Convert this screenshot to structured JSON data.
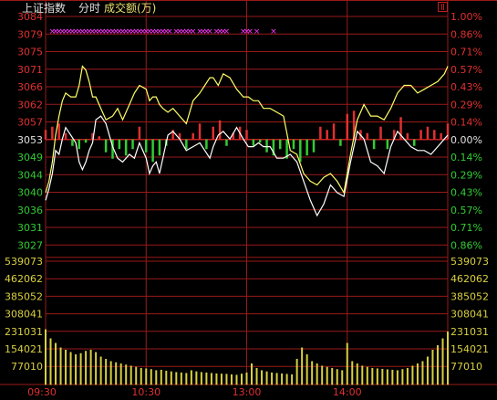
{
  "header": {
    "index_name": "上证指数",
    "time_mode": "分时",
    "volume_label": "成交额(万)"
  },
  "colors": {
    "up": "#e03030",
    "down": "#33cc33",
    "flat": "#e0e0e0",
    "grid": "#9a1a1a",
    "volume": "#d9d040",
    "price_line": "#ffffff",
    "avg_line": "#ffff66",
    "signal_marker": "#ff33ff"
  },
  "chart_data": {
    "type": "line",
    "title": "",
    "price_axis": {
      "left_ticks": [
        "3084",
        "3079",
        "3075",
        "3071",
        "3066",
        "3062",
        "3057",
        "3053",
        "3049",
        "3044",
        "3040",
        "3036",
        "3031",
        "3027"
      ],
      "right_ticks": [
        "1.00%",
        "0.86%",
        "0.71%",
        "0.57%",
        "0.43%",
        "0.29%",
        "0.14%",
        "0.00%",
        "0.14%",
        "0.29%",
        "0.43%",
        "0.57%",
        "0.71%",
        "0.86%"
      ],
      "prev_close": 3053,
      "ylim": [
        3022.5,
        3084
      ]
    },
    "volume_axis": {
      "ticks": [
        "539073",
        "462062",
        "385052",
        "308041",
        "231031",
        "154021",
        "77010"
      ],
      "ylim": [
        0,
        616084
      ]
    },
    "time_axis": {
      "ticks": [
        "09:30",
        "10:30",
        "13:00",
        "14:00"
      ],
      "total_minutes": 240
    },
    "series": [
      {
        "name": "",
        "role": "price",
        "x": [
          0,
          2,
          4,
          6,
          8,
          10,
          12,
          15,
          18,
          20,
          22,
          24,
          26,
          28,
          30,
          33,
          36,
          40,
          43,
          46,
          50,
          53,
          56,
          60,
          62,
          64,
          66,
          68,
          70,
          73,
          76,
          80,
          84,
          88,
          92,
          95,
          98,
          100,
          103,
          106,
          110,
          114,
          118,
          121,
          124,
          127,
          130,
          134,
          138,
          142,
          146,
          150,
          154,
          158,
          162,
          166,
          170,
          174,
          178,
          182,
          186,
          190,
          194,
          198,
          202,
          206,
          210,
          214,
          218,
          222,
          226,
          230,
          234,
          238,
          240
        ],
        "values": [
          3036,
          3039,
          3043,
          3049,
          3048,
          3052,
          3055,
          3053,
          3051,
          3046,
          3044,
          3046,
          3049,
          3051,
          3057,
          3058,
          3056,
          3050,
          3047,
          3046,
          3048,
          3047,
          3051,
          3047,
          3043,
          3045,
          3046,
          3043,
          3047,
          3053,
          3054,
          3052,
          3049,
          3050,
          3051,
          3049,
          3047,
          3050,
          3053,
          3054,
          3052,
          3055,
          3052,
          3050,
          3050,
          3051,
          3050,
          3050,
          3047,
          3047,
          3048,
          3046,
          3041,
          3036,
          3032,
          3035,
          3040,
          3038,
          3037,
          3046,
          3054,
          3052,
          3046,
          3045,
          3043,
          3050,
          3054,
          3052,
          3050,
          3049,
          3049,
          3048,
          3050,
          3052,
          3053
        ]
      },
      {
        "name": "",
        "role": "average",
        "x": [
          0,
          2,
          4,
          6,
          8,
          10,
          12,
          15,
          18,
          20,
          22,
          24,
          26,
          28,
          30,
          33,
          36,
          40,
          43,
          46,
          50,
          53,
          56,
          60,
          62,
          64,
          66,
          68,
          70,
          73,
          76,
          80,
          84,
          88,
          92,
          95,
          98,
          100,
          103,
          106,
          110,
          114,
          118,
          121,
          124,
          127,
          130,
          134,
          138,
          142,
          146,
          150,
          154,
          158,
          162,
          166,
          170,
          174,
          178,
          182,
          186,
          190,
          194,
          198,
          202,
          206,
          210,
          214,
          218,
          222,
          226,
          230,
          234,
          238,
          240
        ],
        "values": [
          3038,
          3041,
          3046,
          3053,
          3058,
          3062,
          3064,
          3063,
          3063,
          3066,
          3071,
          3070,
          3067,
          3063,
          3063,
          3060,
          3057,
          3058,
          3060,
          3057,
          3061,
          3064,
          3066,
          3065,
          3062,
          3063,
          3063,
          3061,
          3060,
          3059,
          3060,
          3058,
          3056,
          3062,
          3064,
          3066,
          3068,
          3068,
          3066,
          3069,
          3068,
          3065,
          3063,
          3063,
          3062,
          3062,
          3060,
          3060,
          3059,
          3058,
          3049,
          3048,
          3043,
          3041,
          3040,
          3042,
          3043,
          3041,
          3038,
          3048,
          3057,
          3061,
          3058,
          3058,
          3057,
          3060,
          3064,
          3066,
          3066,
          3064,
          3065,
          3066,
          3067,
          3069,
          3071
        ]
      }
    ],
    "bars": [
      {
        "role": "up_down",
        "x": [
          0,
          4,
          8,
          12,
          16,
          20,
          24,
          28,
          32,
          36,
          40,
          44,
          48,
          52,
          56,
          60,
          64,
          68,
          72,
          76,
          80,
          84,
          88,
          92,
          96,
          100,
          104,
          108,
          112,
          116,
          120,
          124,
          128,
          132,
          136,
          140,
          144,
          148,
          152,
          156,
          160,
          164,
          168,
          172,
          176,
          180,
          184,
          188,
          192,
          196,
          200,
          204,
          208,
          212,
          216,
          220,
          224,
          228,
          232,
          236,
          240
        ],
        "values": [
          3,
          4,
          5,
          2,
          -2,
          -3,
          -1,
          2,
          1,
          -4,
          -6,
          -3,
          -5,
          -3,
          4,
          -4,
          -7,
          -5,
          -2,
          3,
          2,
          -3,
          2,
          5,
          -3,
          4,
          6,
          -2,
          2,
          4,
          3,
          -2,
          -1,
          -4,
          -5,
          -3,
          -6,
          -3,
          -7,
          -5,
          -4,
          4,
          3,
          5,
          -2,
          8,
          9,
          3,
          2,
          -3,
          4,
          -3,
          3,
          7,
          2,
          -2,
          3,
          4,
          3,
          2,
          5
        ]
      }
    ],
    "volume": {
      "x": [
        0,
        3,
        6,
        9,
        12,
        15,
        18,
        21,
        24,
        27,
        30,
        33,
        36,
        39,
        42,
        45,
        48,
        51,
        54,
        57,
        60,
        63,
        66,
        69,
        72,
        75,
        78,
        81,
        84,
        87,
        90,
        93,
        96,
        99,
        102,
        105,
        108,
        111,
        114,
        117,
        120,
        123,
        126,
        129,
        132,
        135,
        138,
        141,
        144,
        147,
        150,
        153,
        156,
        159,
        162,
        165,
        168,
        171,
        174,
        177,
        180,
        183,
        186,
        189,
        192,
        195,
        198,
        201,
        204,
        207,
        210,
        213,
        216,
        219,
        222,
        225,
        228,
        231,
        234,
        237,
        240
      ],
      "values": [
        240000,
        200000,
        180000,
        160000,
        150000,
        140000,
        130000,
        135000,
        145000,
        150000,
        140000,
        120000,
        110000,
        100000,
        95000,
        90000,
        85000,
        80000,
        75000,
        70000,
        68000,
        65000,
        60000,
        62000,
        58000,
        55000,
        52000,
        50000,
        48000,
        60000,
        55000,
        52000,
        50000,
        48000,
        46000,
        45000,
        44000,
        42000,
        40000,
        45000,
        50000,
        90000,
        70000,
        60000,
        55000,
        50000,
        48000,
        46000,
        44000,
        42000,
        110000,
        160000,
        130000,
        100000,
        90000,
        80000,
        75000,
        70000,
        65000,
        60000,
        180000,
        100000,
        90000,
        80000,
        75000,
        70000,
        68000,
        66000,
        64000,
        62000,
        60000,
        65000,
        70000,
        80000,
        90000,
        100000,
        120000,
        150000,
        170000,
        200000,
        230000
      ]
    },
    "signals": {
      "x": [
        4,
        6,
        8,
        10,
        12,
        14,
        16,
        18,
        20,
        22,
        24,
        26,
        28,
        30,
        32,
        34,
        36,
        38,
        40,
        42,
        44,
        46,
        48,
        50,
        52,
        54,
        56,
        58,
        60,
        62,
        64,
        66,
        68,
        70,
        72,
        74,
        78,
        80,
        82,
        84,
        86,
        88,
        92,
        94,
        96,
        98,
        102,
        104,
        106,
        108,
        118,
        120,
        122,
        126,
        136
      ],
      "label": "×"
    },
    "grid": true,
    "legend": "none"
  }
}
